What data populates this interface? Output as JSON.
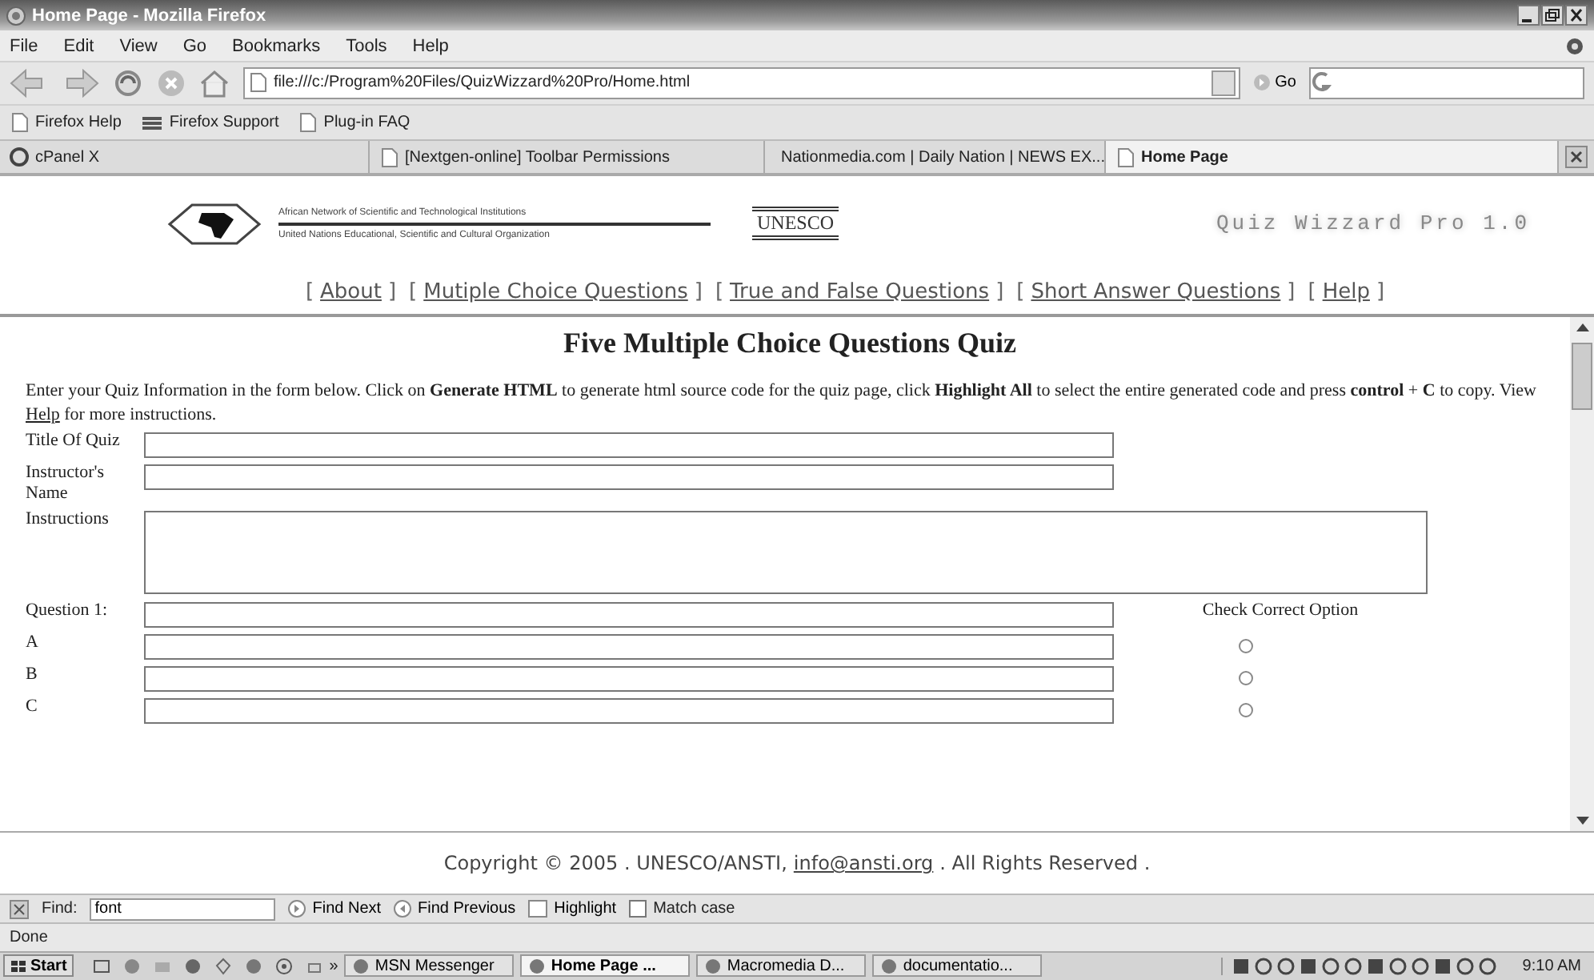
{
  "window": {
    "title": "Home Page - Mozilla Firefox"
  },
  "menu": [
    "File",
    "Edit",
    "View",
    "Go",
    "Bookmarks",
    "Tools",
    "Help"
  ],
  "address": {
    "value": "file:///c:/Program%20Files/QuizWizzard%20Pro/Home.html",
    "go": "Go"
  },
  "bookmarks": [
    {
      "label": "Firefox Help",
      "kind": "page"
    },
    {
      "label": "Firefox Support",
      "kind": "feed"
    },
    {
      "label": "Plug-in FAQ",
      "kind": "page"
    }
  ],
  "tabs": [
    {
      "label": "cPanel X",
      "selected": false
    },
    {
      "label": "[Nextgen-online] Toolbar Permissions",
      "selected": false
    },
    {
      "label": "Nationmedia.com | Daily Nation | NEWS EX...",
      "selected": false
    },
    {
      "label": "Home Page",
      "selected": true
    }
  ],
  "header": {
    "network": "African Network of Scientific and Technological Institutions",
    "unesco_full": "United Nations Educational, Scientific and Cultural Organization",
    "unesco": "UNESCO",
    "product": "Quiz Wizzard Pro 1.0"
  },
  "nav_links": [
    {
      "before": "[",
      "label": "About",
      "after": "]"
    },
    {
      "before": "[",
      "label": "Mutiple Choice Questions",
      "after": "]"
    },
    {
      "before": "[",
      "label": "True and False Questions",
      "after": "]"
    },
    {
      "before": "[",
      "label": "Short Answer Questions",
      "after": "]"
    },
    {
      "before": "[",
      "label": "Help",
      "after": "]"
    }
  ],
  "page": {
    "heading": "Five Multiple Choice Questions Quiz",
    "intro": "Enter your Quiz Information in the form below. Click on **Generate HTML** to generate html source code for the quiz page, click **Highlight All** to select the entire generated code and press **control** + **C** to copy. View",
    "intro_link": "Help",
    "intro_end": "for more instructions.",
    "fields": [
      {
        "label": "Title Of Quiz",
        "kind": "text"
      },
      {
        "label": "Instructor's Name",
        "kind": "text"
      },
      {
        "label": "Instructions",
        "kind": "textarea"
      }
    ],
    "question": {
      "label": "Question 1:",
      "aside": "Check Correct Option"
    },
    "options": [
      {
        "label": "A",
        "selected": false
      },
      {
        "label": "B",
        "selected": false
      },
      {
        "label": "C",
        "selected": false
      }
    ]
  },
  "copyright": {
    "text": "Copyright © 2005 . UNESCO/ANSTI,",
    "email": "info@ansti.org",
    "end": ". All Rights Reserved ."
  },
  "find_bar": {
    "label": "Find:",
    "value": "font",
    "next": "Find Next",
    "previous": "Find Previous",
    "highlight": "Highlight",
    "match_case": {
      "label": "Match case",
      "checked": false
    }
  },
  "status_bar": "Done",
  "taskbar": {
    "start": "Start",
    "more": "»",
    "tasks": [
      {
        "label": "MSN Messenger",
        "selected": false
      },
      {
        "label": "Home Page ...",
        "selected": true
      },
      {
        "label": "Macromedia D...",
        "selected": false
      },
      {
        "label": "documentatio...",
        "selected": false
      }
    ],
    "clock": "9:10 AM"
  }
}
